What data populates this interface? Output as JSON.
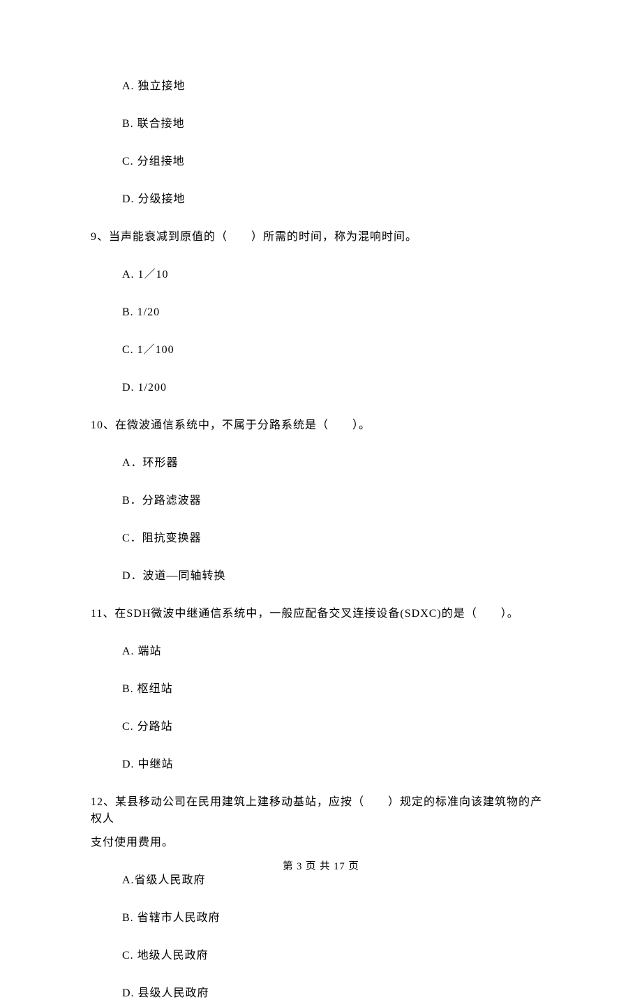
{
  "q8": {
    "a": "A.  独立接地",
    "b": "B.  联合接地",
    "c": "C.  分组接地",
    "d": "D.  分级接地"
  },
  "q9": {
    "stem": "9、当声能衰减到原值的（　　）所需的时间，称为混响时间。",
    "a": "A.   1／10",
    "b": "B.   1/20",
    "c": "C.   1／100",
    "d": "D.   1/200"
  },
  "q10": {
    "stem": "10、在微波通信系统中，不属于分路系统是（　　）。",
    "a": "A．环形器",
    "b": "B．分路滤波器",
    "c": "C．阻抗变换器",
    "d": "D．波道—同轴转换"
  },
  "q11": {
    "stem": "11、在SDH微波中继通信系统中，一般应配备交叉连接设备(SDXC)的是（　　）。",
    "a": "A.  端站",
    "b": "B.  枢纽站",
    "c": "C.  分路站",
    "d": "D.  中继站"
  },
  "q12": {
    "stem_line1": "12、某县移动公司在民用建筑上建移动基站，应按（　　）规定的标准向该建筑物的产权人",
    "stem_line2": "支付使用费用。",
    "a": "A.省级人民政府",
    "b": "B.  省辖市人民政府",
    "c": "C.  地级人民政府",
    "d": "D.  县级人民政府"
  },
  "footer": "第 3 页 共 17 页"
}
